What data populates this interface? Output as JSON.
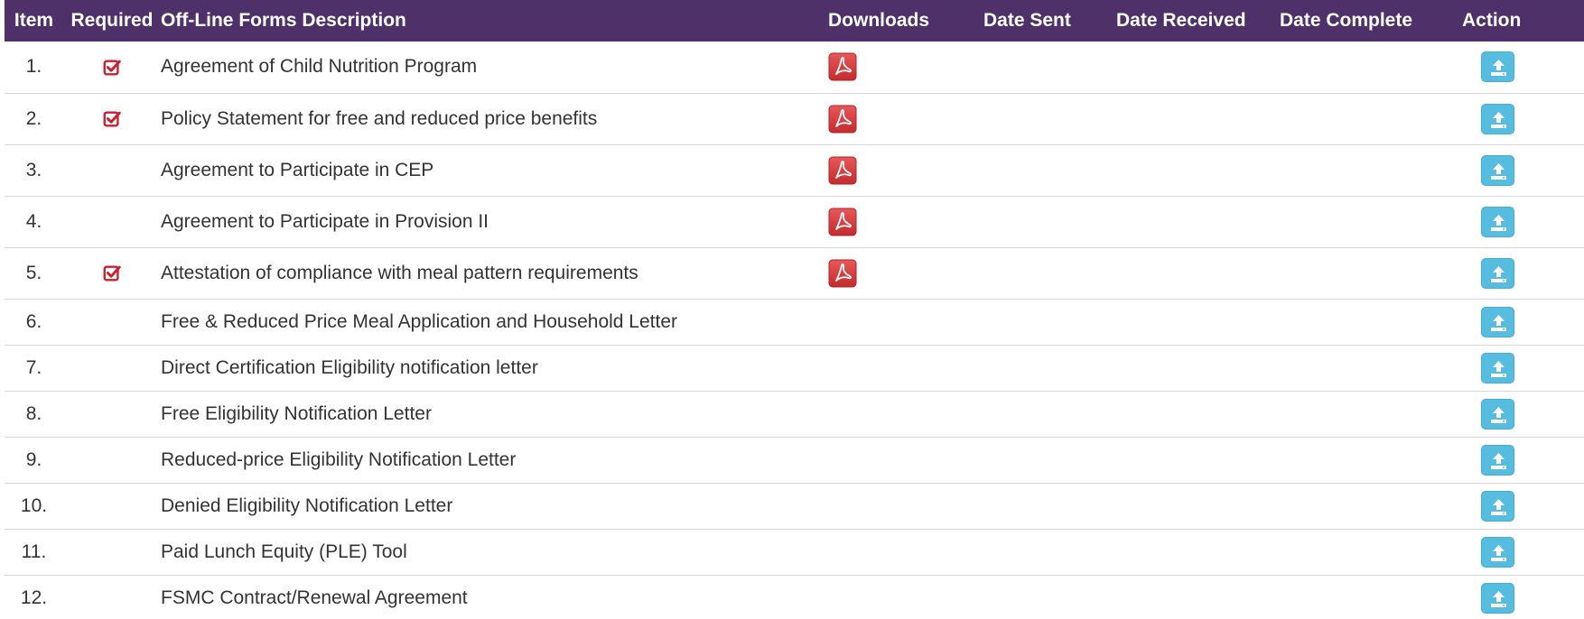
{
  "table": {
    "headers": {
      "item": "Item",
      "required": "Required",
      "description": "Off-Line Forms Description",
      "downloads": "Downloads",
      "date_sent": "Date Sent",
      "date_received": "Date Received",
      "date_complete": "Date Complete",
      "action": "Action"
    },
    "rows": [
      {
        "item": "1.",
        "required": true,
        "description": "Agreement of Child Nutrition Program",
        "download": "pdf-icon",
        "date_sent": "",
        "date_received": "",
        "date_complete": "",
        "action": "upload-icon"
      },
      {
        "item": "2.",
        "required": true,
        "description": "Policy Statement for free and reduced price benefits",
        "download": "pdf-icon",
        "date_sent": "",
        "date_received": "",
        "date_complete": "",
        "action": "upload-icon"
      },
      {
        "item": "3.",
        "required": false,
        "description": "Agreement to Participate in CEP",
        "download": "pdf-icon",
        "date_sent": "",
        "date_received": "",
        "date_complete": "",
        "action": "upload-icon"
      },
      {
        "item": "4.",
        "required": false,
        "description": "Agreement to Participate in Provision II",
        "download": "pdf-icon",
        "date_sent": "",
        "date_received": "",
        "date_complete": "",
        "action": "upload-icon"
      },
      {
        "item": "5.",
        "required": true,
        "description": "Attestation of compliance with meal pattern requirements",
        "download": "pdf-icon",
        "date_sent": "",
        "date_received": "",
        "date_complete": "",
        "action": "upload-icon"
      },
      {
        "item": "6.",
        "required": false,
        "description": "Free & Reduced Price Meal Application and Household Letter",
        "download": "",
        "date_sent": "",
        "date_received": "",
        "date_complete": "",
        "action": "upload-icon"
      },
      {
        "item": "7.",
        "required": false,
        "description": "Direct Certification Eligibility notification letter",
        "download": "",
        "date_sent": "",
        "date_received": "",
        "date_complete": "",
        "action": "upload-icon"
      },
      {
        "item": "8.",
        "required": false,
        "description": "Free Eligibility Notification Letter",
        "download": "",
        "date_sent": "",
        "date_received": "",
        "date_complete": "",
        "action": "upload-icon"
      },
      {
        "item": "9.",
        "required": false,
        "description": "Reduced-price Eligibility Notification Letter",
        "download": "",
        "date_sent": "",
        "date_received": "",
        "date_complete": "",
        "action": "upload-icon"
      },
      {
        "item": "10.",
        "required": false,
        "description": "Denied Eligibility Notification Letter",
        "download": "",
        "date_sent": "",
        "date_received": "",
        "date_complete": "",
        "action": "upload-icon"
      },
      {
        "item": "11.",
        "required": false,
        "description": "Paid Lunch Equity (PLE) Tool",
        "download": "",
        "date_sent": "",
        "date_received": "",
        "date_complete": "",
        "action": "upload-icon"
      },
      {
        "item": "12.",
        "required": false,
        "description": "FSMC Contract/Renewal Agreement",
        "download": "",
        "date_sent": "",
        "date_received": "",
        "date_complete": "",
        "action": "upload-icon"
      }
    ]
  },
  "colors": {
    "header_bg": "#4e3169",
    "header_text": "#ffffff",
    "check_red": "#cc1f2e",
    "pdf_red": "#d9393a",
    "upload_blue": "#56bde0",
    "row_border": "#d6d6d6"
  }
}
